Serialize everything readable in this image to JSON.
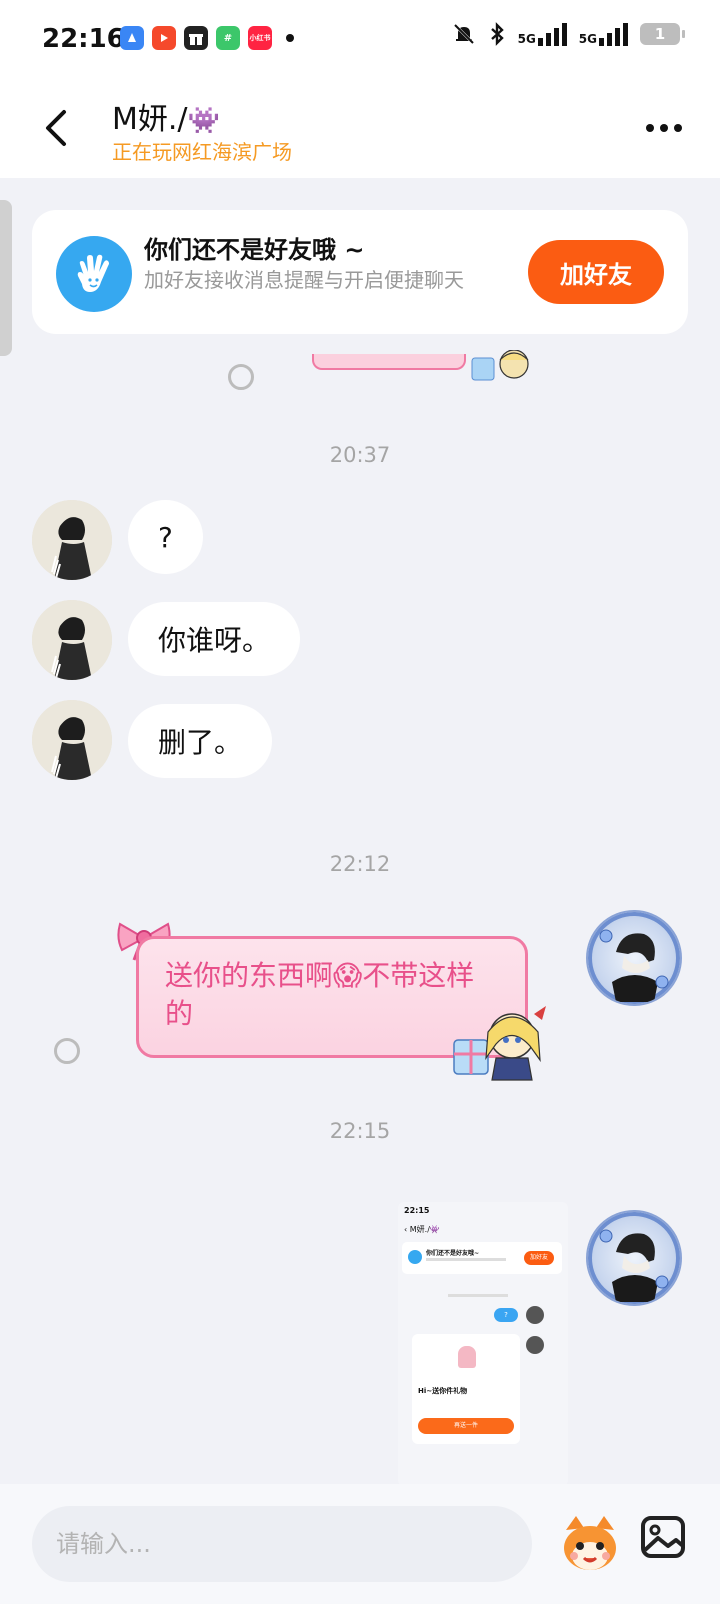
{
  "status_bar": {
    "time": "22:16",
    "apps": [
      {
        "icon": "blue-app-icon",
        "color": "#3a86f5",
        "label": ""
      },
      {
        "icon": "video-app-icon",
        "color": "#f5492b",
        "label": ""
      },
      {
        "icon": "gift-app-icon",
        "color": "#222222",
        "label": ""
      },
      {
        "icon": "wechat-app-icon",
        "color": "#3cc76a",
        "label": "#"
      },
      {
        "icon": "xiaohongshu-app-icon",
        "color": "#ff2442",
        "label": "小红书"
      }
    ],
    "net1": "5G",
    "net2": "5G",
    "battery": "1"
  },
  "header": {
    "title": "M妍./",
    "title_emoji": "👾",
    "subtitle": "正在玩网红海滨广场"
  },
  "friend_banner": {
    "title": "你们还不是好友哦 ~",
    "description": "加好友接收消息提醒与开启便捷聊天",
    "button": "加好友"
  },
  "messages": {
    "time_1": "20:37",
    "left_1": "?",
    "left_2": "你谁呀。",
    "left_3": "删了。",
    "time_2": "22:12",
    "right_1": "送你的东西啊😱不带这样的",
    "time_3": "22:15"
  },
  "thumbnail": {
    "time": "22:15",
    "title": "M妍./👾",
    "banner_title": "你们还不是好友哦~",
    "banner_button": "加好友",
    "bubble": "?",
    "gift_text": "Hi~送你件礼物",
    "gift_button": "再送一件"
  },
  "input": {
    "placeholder": "请输入..."
  },
  "colors": {
    "accent": "#fb5c12",
    "subtitle": "#f59a23",
    "pink_text": "#e8508a",
    "hand_bg": "#36a8f0"
  }
}
